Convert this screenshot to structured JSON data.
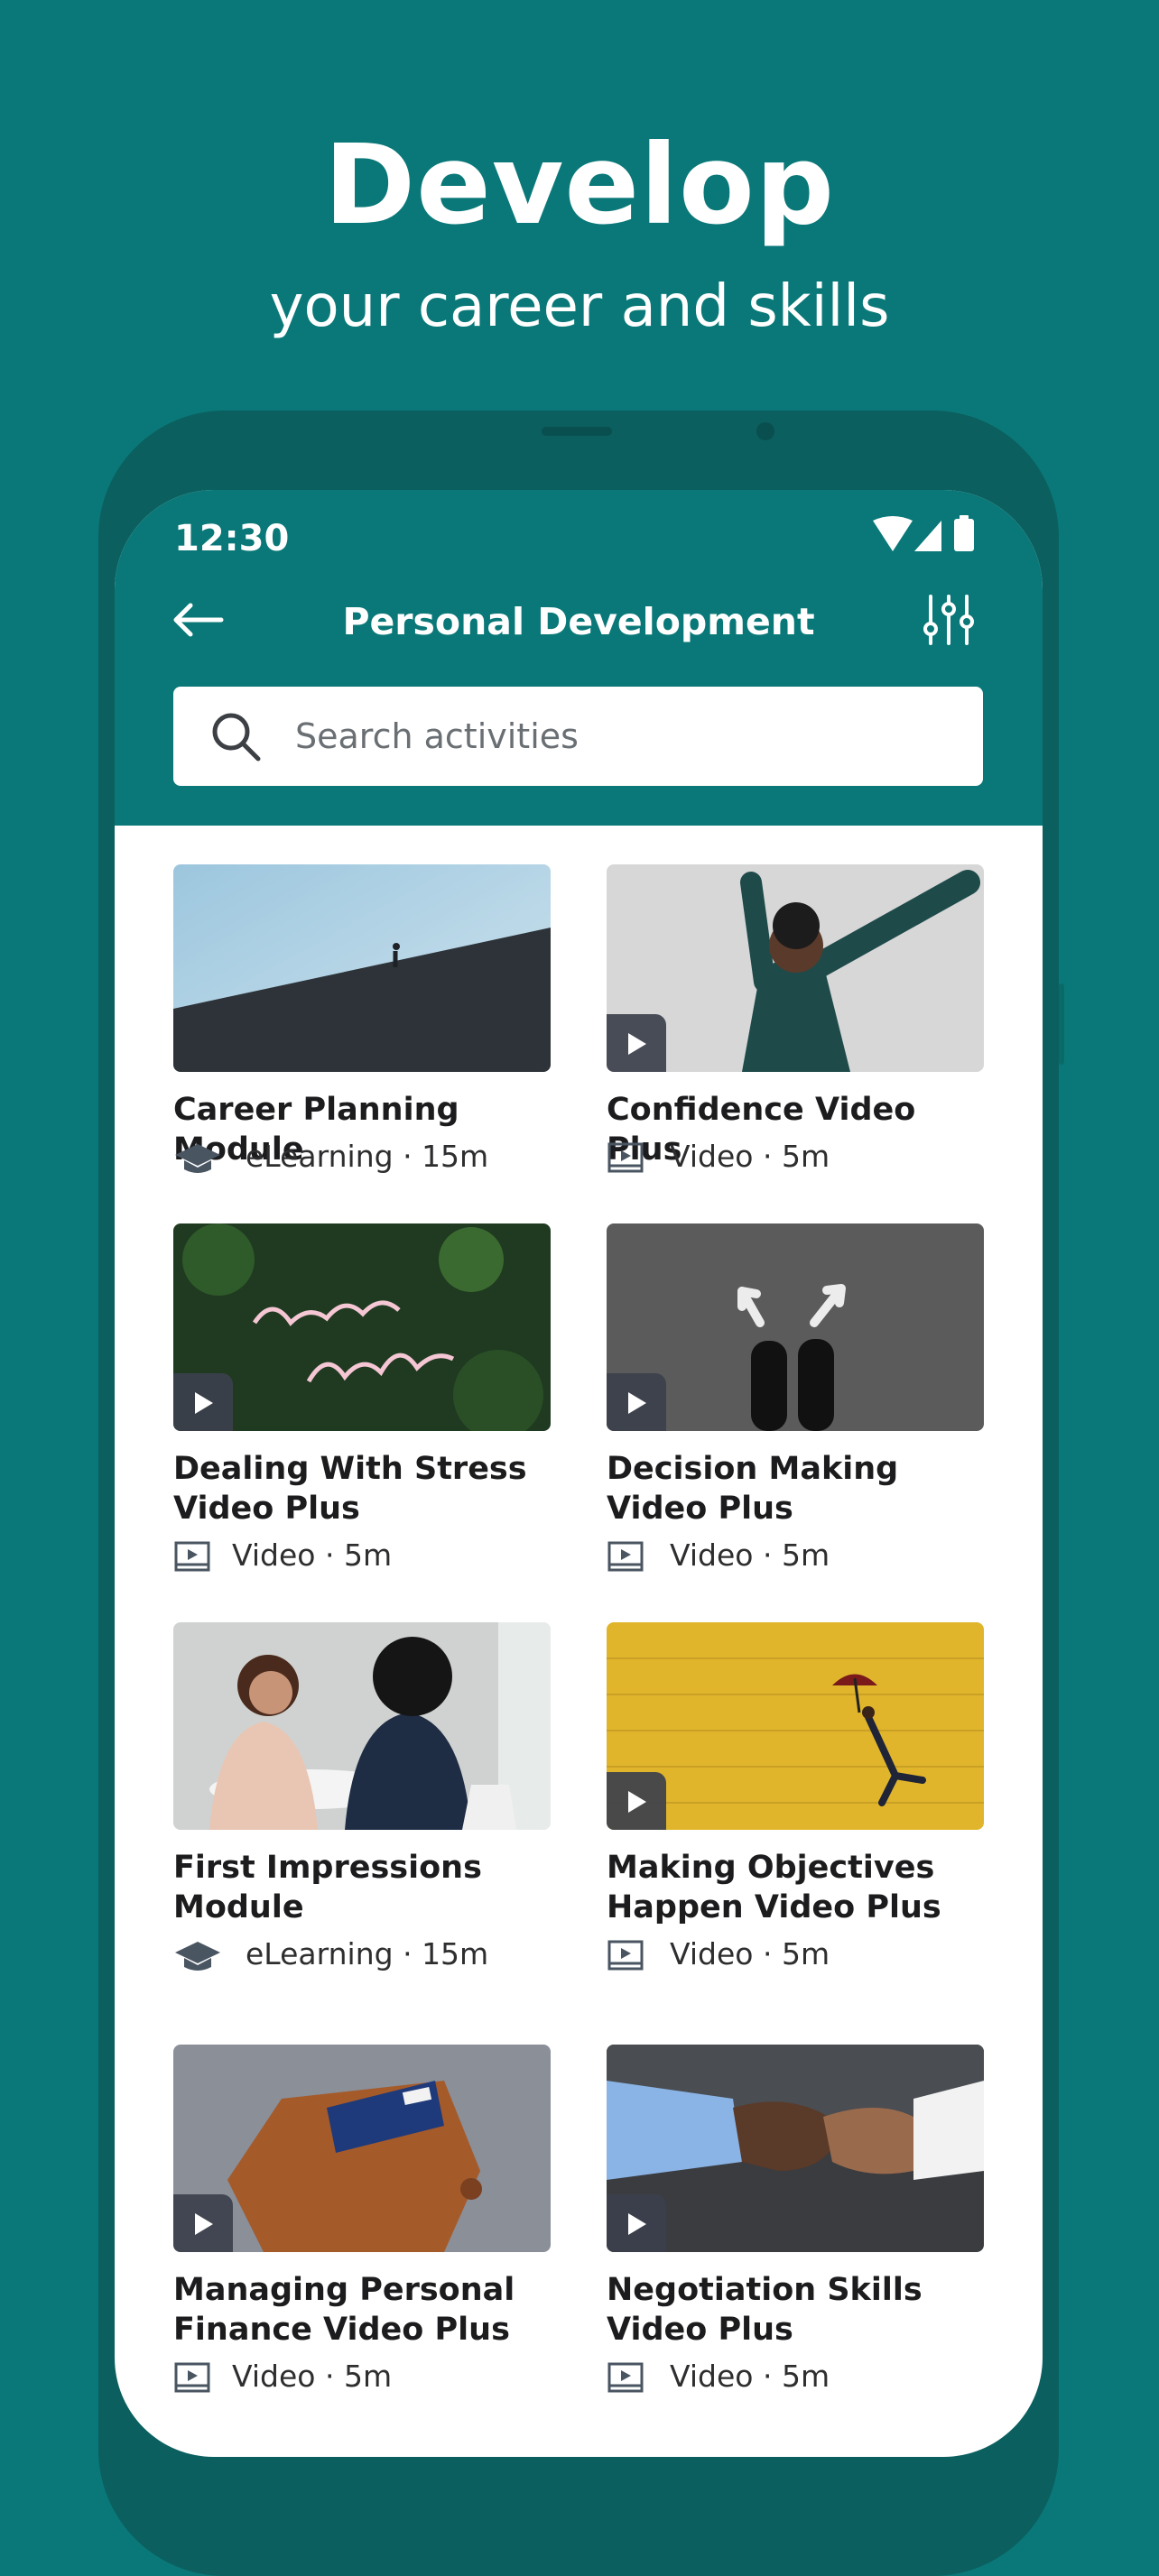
{
  "hero": {
    "title": "Develop",
    "subtitle": "your career and skills"
  },
  "status_bar": {
    "time": "12:30"
  },
  "header": {
    "title": "Personal Development"
  },
  "search": {
    "placeholder": "Search activities"
  },
  "colors": {
    "brand": "#0a7878",
    "phone_frame": "#0b5f5f",
    "play_badge": "#3c404c",
    "meta_icon": "#4a5562"
  },
  "activities": [
    {
      "title": "Career Planning Module",
      "type": "eLearning",
      "duration": "15m",
      "type_icon": "graduation-cap-icon",
      "has_play_badge": false
    },
    {
      "title": "Confidence Video Plus",
      "type": "Video",
      "duration": "5m",
      "type_icon": "video-icon",
      "has_play_badge": true
    },
    {
      "title": "Dealing With Stress Video Plus",
      "type": "Video",
      "duration": "5m",
      "type_icon": "video-icon",
      "has_play_badge": true
    },
    {
      "title": "Decision Making Video Plus",
      "type": "Video",
      "duration": "5m",
      "type_icon": "video-icon",
      "has_play_badge": true
    },
    {
      "title": "First Impressions Module",
      "type": "eLearning",
      "duration": "15m",
      "type_icon": "graduation-cap-icon",
      "has_play_badge": false
    },
    {
      "title": "Making Objectives Happen Video Plus",
      "type": "Video",
      "duration": "5m",
      "type_icon": "video-icon",
      "has_play_badge": true
    },
    {
      "title": "Managing Personal Finance Video Plus",
      "type": "Video",
      "duration": "5m",
      "type_icon": "video-icon",
      "has_play_badge": true
    },
    {
      "title": "Negotiation Skills Video Plus",
      "type": "Video",
      "duration": "5m",
      "type_icon": "video-icon",
      "has_play_badge": true
    }
  ],
  "meta_separator": " · "
}
